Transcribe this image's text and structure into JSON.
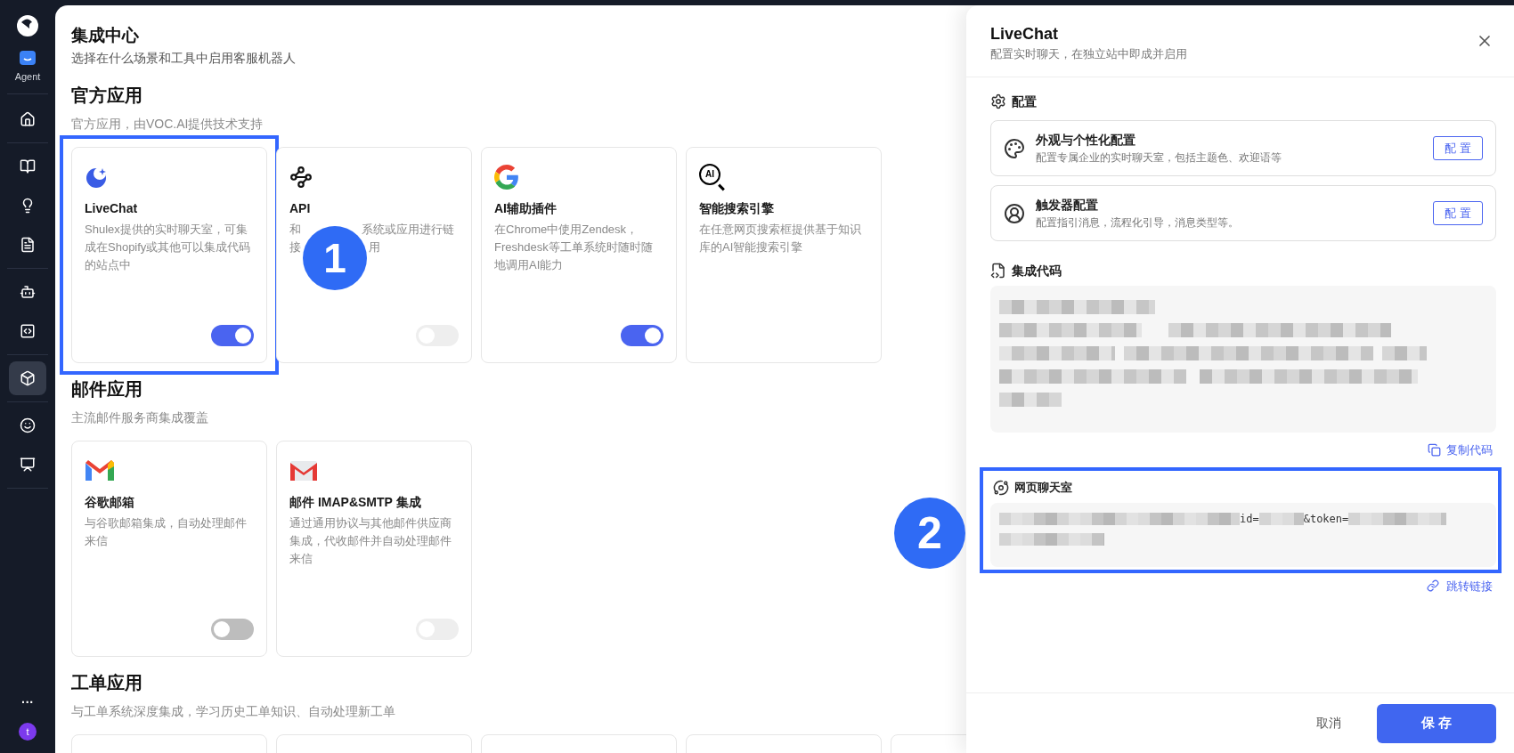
{
  "sidebar": {
    "agent_label": "Agent",
    "items": [
      {
        "selected": false
      },
      {
        "selected": false
      },
      {
        "selected": false
      },
      {
        "selected": false
      },
      {
        "selected": false
      },
      {
        "selected": false
      },
      {
        "selected": true
      },
      {
        "selected": false
      },
      {
        "selected": false
      }
    ],
    "more": "···",
    "avatar": "t"
  },
  "page": {
    "title": "集成中心",
    "subtitle": "选择在什么场景和工具中启用客服机器人"
  },
  "sections": [
    {
      "title": "官方应用",
      "subtitle": "官方应用，由VOC.AI提供技术支持",
      "cards": [
        {
          "kind": "livechat",
          "name": "LiveChat",
          "desc": "Shulex提供的实时聊天室，可集成在Shopify或其他可以集成代码的站点中",
          "switch": {
            "on": true,
            "disabled": false
          }
        },
        {
          "kind": "api",
          "name": "API",
          "desc_lines": [
            [
              "和",
              "系统或应用进行链"
            ],
            [
              "接",
              "用"
            ]
          ],
          "switch": {
            "on": false,
            "disabled": true
          }
        },
        {
          "kind": "google",
          "name": "AI辅助插件",
          "desc": "在Chrome中使用Zendesk，Freshdesk等工单系统时随时随地调用AI能力",
          "switch": {
            "on": true,
            "disabled": false
          }
        },
        {
          "kind": "ai_search",
          "name": "智能搜索引擎",
          "icon_text": "AI",
          "desc": "在任意网页搜索框提供基于知识库的AI智能搜索引擎"
        }
      ]
    },
    {
      "title": "邮件应用",
      "subtitle": "主流邮件服务商集成覆盖",
      "cards": [
        {
          "kind": "gmail",
          "name": "谷歌邮箱",
          "desc": "与谷歌邮箱集成，自动处理邮件来信",
          "switch": {
            "on": false,
            "disabled": false
          }
        },
        {
          "kind": "imap",
          "name": "邮件 IMAP&SMTP 集成",
          "desc": "通过通用协议与其他邮件供应商集成，代收邮件并自动处理邮件来信",
          "switch": {
            "on": false,
            "disabled": true
          }
        }
      ]
    },
    {
      "title": "工单应用",
      "subtitle": "与工单系统深度集成，学习历史工单知识、自动处理新工单",
      "cards": [
        {
          "kind": "blank"
        },
        {
          "kind": "blank"
        },
        {
          "kind": "blank"
        },
        {
          "kind": "blank"
        },
        {
          "kind": "blank"
        }
      ]
    }
  ],
  "drawer": {
    "title": "LiveChat",
    "subtitle": "配置实时聊天，在独立站中即成并启用",
    "config": {
      "heading": "配置",
      "items": [
        {
          "kind": "appearance",
          "title": "外观与个性化配置",
          "desc": "配置专属企业的实时聊天室，包括主题色、欢迎语等",
          "button": "配 置"
        },
        {
          "kind": "trigger",
          "title": "触发器配置",
          "desc": "配置指引消息，流程化引导，消息类型等。",
          "button": "配 置"
        }
      ]
    },
    "code": {
      "heading": "集成代码",
      "copy": "复制代码"
    },
    "webchat": {
      "heading": "网页聊天室",
      "id_label": "id=",
      "token_label": "&token=",
      "jump": "跳转链接"
    },
    "cancel": "取消",
    "save": "保 存"
  },
  "annotations": [
    {
      "label": "1"
    },
    {
      "label": "2"
    }
  ]
}
